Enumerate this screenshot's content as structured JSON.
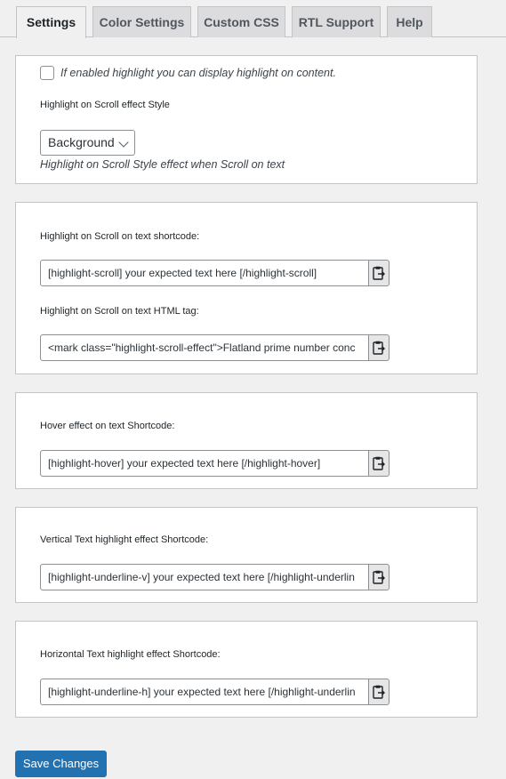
{
  "tabs": [
    "Settings",
    "Color Settings",
    "Custom CSS",
    "RTL Support",
    "Help"
  ],
  "panel1": {
    "checkbox_label": "If enabled highlight you can display highlight on content.",
    "style_label": "Highlight on Scroll effect Style",
    "style_value": "Background",
    "style_desc": "Highlight on Scroll Style effect when Scroll on text"
  },
  "panel2": {
    "shortcode_label": "Highlight on Scroll on text shortcode:",
    "shortcode_value": "[highlight-scroll] your expected text here [/highlight-scroll]",
    "html_label": "Highlight on Scroll on text HTML tag:",
    "html_value": "<mark class=\"highlight-scroll-effect\">Flatland prime number conc"
  },
  "panel3": {
    "label": "Hover effect on text Shortcode:",
    "value": "[highlight-hover] your expected text here [/highlight-hover]"
  },
  "panel4": {
    "label": "Vertical Text highlight effect Shortcode:",
    "value": "[highlight-underline-v] your expected text here [/highlight-underlin"
  },
  "panel5": {
    "label": "Horizontal Text highlight effect Shortcode:",
    "value": "[highlight-underline-h] your expected text here [/highlight-underlin"
  },
  "save_label": "Save Changes",
  "icons": {
    "copy": "clipboard-icon",
    "dropdown": "chevron-down-icon"
  },
  "colors": {
    "primary": "#2271b1",
    "background": "#f0f0f1"
  }
}
